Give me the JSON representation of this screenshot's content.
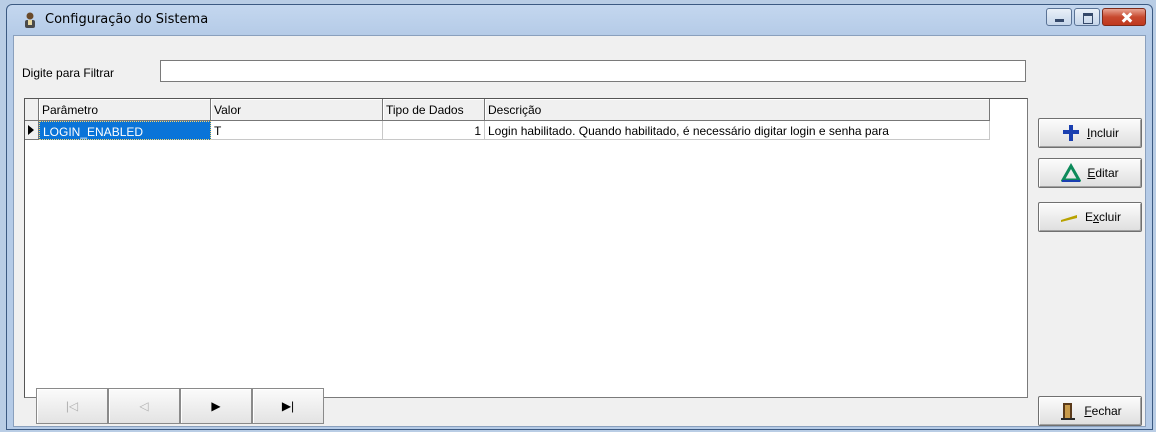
{
  "window": {
    "title": "Configuração do Sistema",
    "title_icon": "user-config-icon"
  },
  "filter": {
    "label": "Digite para Filtrar",
    "value": "",
    "placeholder": ""
  },
  "grid": {
    "columns": [
      "Parâmetro",
      "Valor",
      "Tipo de Dados",
      "Descrição"
    ],
    "rows": [
      {
        "parametro": "LOGIN_ENABLED",
        "valor": "T",
        "tipo": "1",
        "descricao": "Login habilitado. Quando habilitado, é necessário digitar login e senha para"
      }
    ]
  },
  "navigator": {
    "first": "|◁",
    "prior": "◁",
    "next": "▶",
    "last": "▶|"
  },
  "buttons": {
    "incluir": {
      "accel": "I",
      "rest": "ncluir",
      "icon": "plus-icon",
      "color": "#1a3fb0"
    },
    "editar": {
      "accel": "E",
      "rest": "ditar",
      "icon": "triangle-icon",
      "color": "#0d8a5a"
    },
    "excluir": {
      "pre": "E",
      "accel": "x",
      "rest": "cluir",
      "icon": "minus-icon",
      "color": "#b8a200"
    },
    "fechar": {
      "accel": "F",
      "rest": "echar",
      "icon": "door-exit-icon"
    }
  }
}
